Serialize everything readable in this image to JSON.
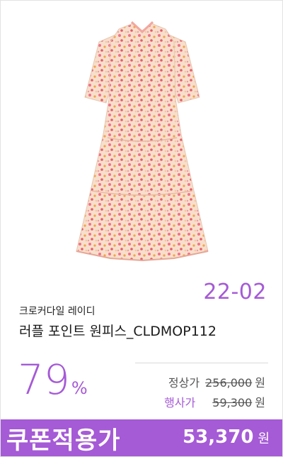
{
  "product": {
    "code": "22-02",
    "brand": "크로커다일 레이디",
    "title": "러플 포인트 원피스_CLDMOP112",
    "discount_value": "79",
    "discount_unit": "%",
    "regular_price_label": "정상가",
    "regular_price": "256,000",
    "event_price_label": "행사가",
    "event_price": "59,300",
    "currency": "원"
  },
  "coupon": {
    "label": "쿠폰적용가",
    "price": "53,370",
    "currency": "원"
  },
  "colors": {
    "accent": "#a55ad6",
    "dress_base": "#f6dfcc",
    "dress_pattern": [
      "#f2708a",
      "#f5a24a",
      "#f7c4a2",
      "#e85a6a",
      "#f9d9b5"
    ]
  },
  "icons": {
    "product_image": "floral-dress-image"
  }
}
